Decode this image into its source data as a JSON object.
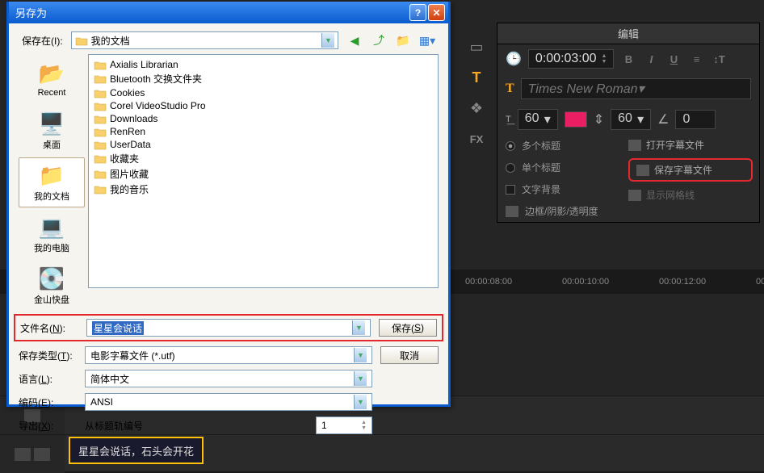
{
  "editor": {
    "tab_title": "编辑",
    "duration": "0:00:03:00",
    "font_name": "Times New Roman",
    "font_size": "60",
    "line_spacing": "60",
    "rotation": "0",
    "opt_multi": "多个标题",
    "opt_single": "单个标题",
    "opt_textbg": "文字背景",
    "opt_border": "边框/阴影/透明度",
    "action_open": "打开字幕文件",
    "action_save": "保存字幕文件",
    "action_grid": "显示网格线"
  },
  "timeline": {
    "t1": "00:00:08:00",
    "t2": "00:00:10:00",
    "t3": "00:00:12:00",
    "t4": "00:"
  },
  "clip": {
    "text": "星星会说话，石头会开花"
  },
  "dialog": {
    "title": "另存为",
    "save_in_label": "保存在(I):",
    "location": "我的文档",
    "places": {
      "recent": "Recent",
      "desktop": "桌面",
      "mydocs": "我的文档",
      "mycomputer": "我的电脑",
      "kingsoft": "金山快盘"
    },
    "files": [
      "Axialis Librarian",
      "Bluetooth 交换文件夹",
      "Cookies",
      "Corel VideoStudio Pro",
      "Downloads",
      "RenRen",
      "UserData",
      "收藏夹",
      "图片收藏",
      "我的音乐"
    ],
    "fn_label": "文件名(N):",
    "filename": "星星会说话",
    "type_label": "保存类型(T):",
    "filetype": "电影字幕文件 (*.utf)",
    "lang_label": "语言(L):",
    "language": "简体中文",
    "enc_label": "编码(E):",
    "encoding": "ANSI",
    "export_label": "导出(X):",
    "export_text": "从标题轨编号",
    "export_num": "1",
    "btn_save": "保存(S)",
    "btn_cancel": "取消"
  }
}
